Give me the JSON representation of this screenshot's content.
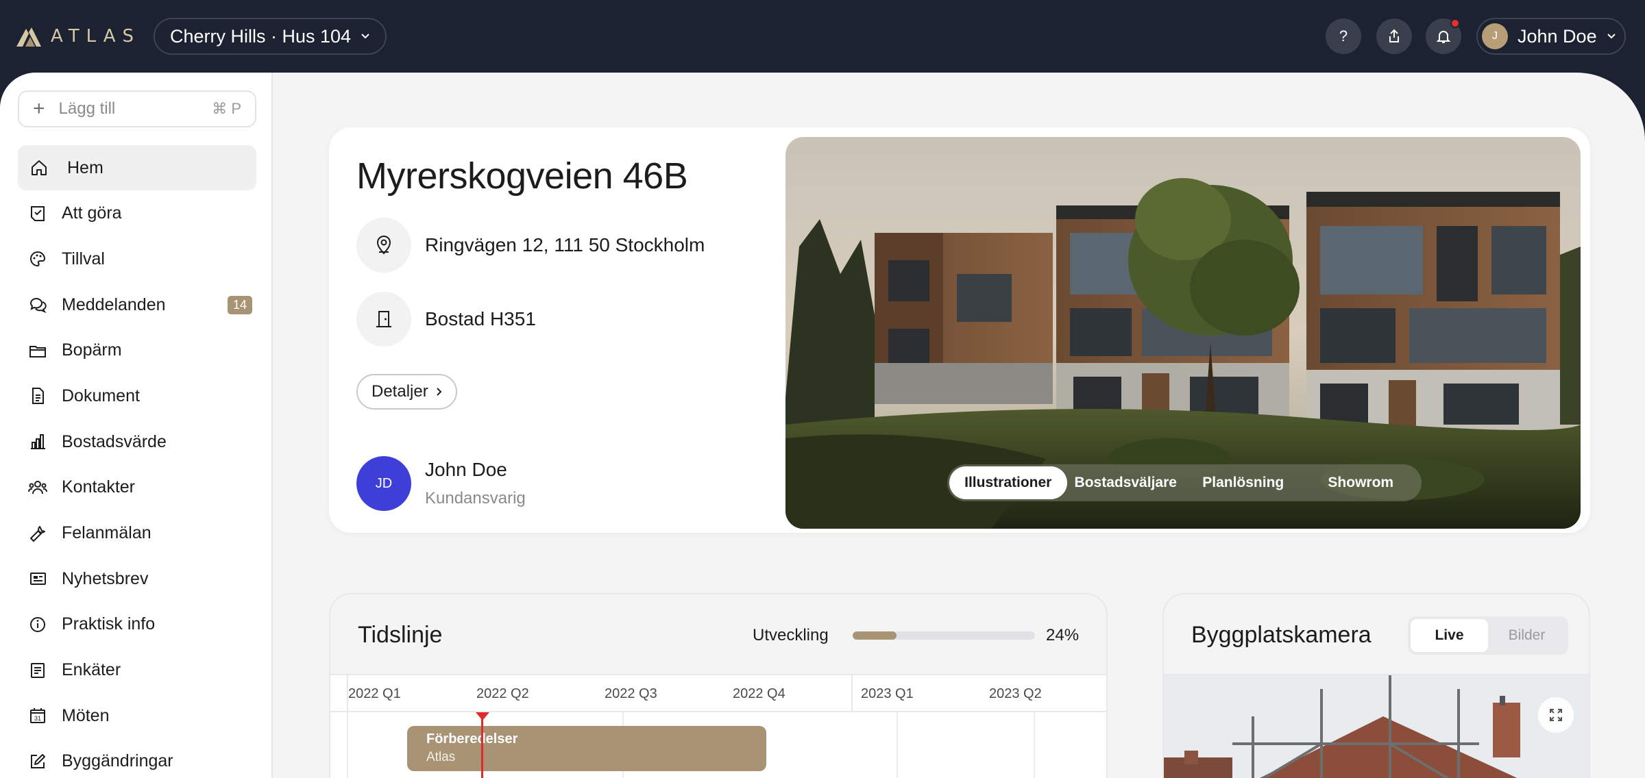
{
  "brand": {
    "name": "ATLAS"
  },
  "header": {
    "project": "Cherry Hills · Hus 104",
    "help": "?",
    "user": {
      "name": "John Doe",
      "initial": "J"
    }
  },
  "sidebar": {
    "add_label": "Lägg till",
    "add_shortcut": "⌘ P",
    "items": [
      {
        "label": "Hem",
        "icon": "home-icon",
        "active": true
      },
      {
        "label": "Att göra",
        "icon": "checklist-icon"
      },
      {
        "label": "Tillval",
        "icon": "palette-icon"
      },
      {
        "label": "Meddelanden",
        "icon": "chat-icon",
        "badge": "14"
      },
      {
        "label": "Bopärm",
        "icon": "folder-icon"
      },
      {
        "label": "Dokument",
        "icon": "document-icon"
      },
      {
        "label": "Bostadsvärde",
        "icon": "bar-chart-icon"
      },
      {
        "label": "Kontakter",
        "icon": "people-icon"
      },
      {
        "label": "Felanmälan",
        "icon": "wrench-icon"
      },
      {
        "label": "Nyhetsbrev",
        "icon": "newspaper-icon"
      },
      {
        "label": "Praktisk info",
        "icon": "info-icon"
      },
      {
        "label": "Enkäter",
        "icon": "form-icon"
      },
      {
        "label": "Möten",
        "icon": "calendar-icon",
        "calendar_day": "31"
      },
      {
        "label": "Byggändringar",
        "icon": "edit-icon"
      }
    ]
  },
  "hero": {
    "title": "Myrerskogveien 46B",
    "address": "Ringvägen 12, 111 50 Stockholm",
    "unit": "Bostad H351",
    "details_button": "Detaljer",
    "contact": {
      "initials": "JD",
      "name": "John Doe",
      "role": "Kundansvarig"
    },
    "photo_tabs": [
      "Illustrationer",
      "Bostadsväljare",
      "Planlösning",
      "Showrom"
    ],
    "active_photo_tab": 0
  },
  "timeline": {
    "title": "Tidslinje",
    "progress_label": "Utveckling",
    "progress_value": 0.24,
    "progress_text": "24%",
    "quarters": [
      "2022 Q1",
      "2022 Q2",
      "2022 Q3",
      "2022 Q4",
      "2023 Q1",
      "2023 Q2"
    ],
    "item": {
      "title": "Förberedelser",
      "subtitle": "Atlas"
    }
  },
  "camera": {
    "title": "Byggplatskamera",
    "modes": [
      "Live",
      "Bilder"
    ],
    "active_mode": 0
  },
  "colors": {
    "topbar": "#1c2232",
    "accent": "#a89474",
    "avatar_blue": "#3e3fd8",
    "notification": "#e5312e",
    "today_marker": "#e12b2b"
  }
}
